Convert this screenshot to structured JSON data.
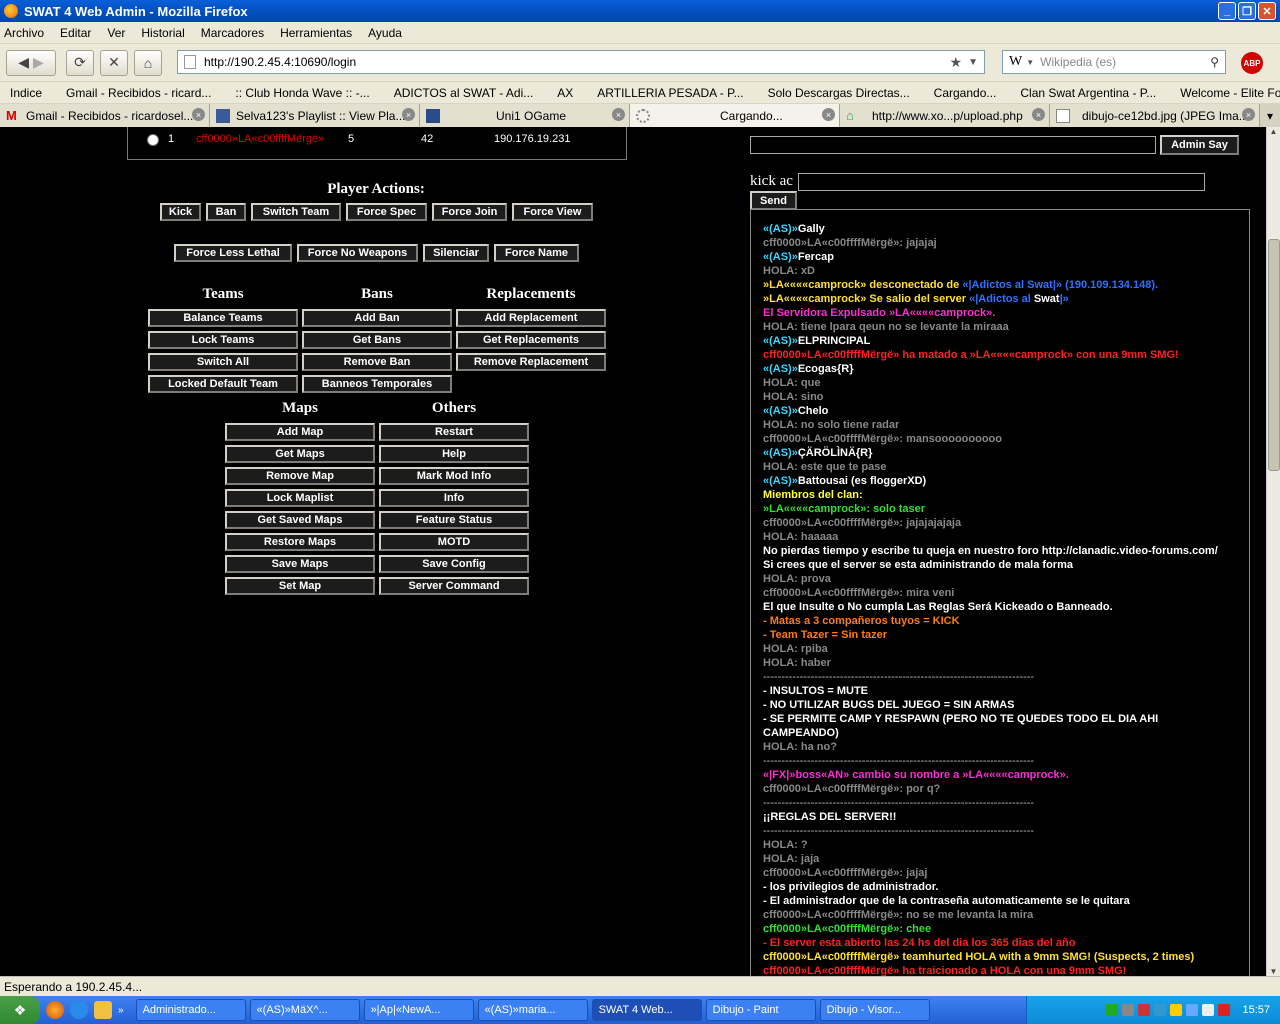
{
  "window": {
    "title": "SWAT 4 Web Admin - Mozilla Firefox"
  },
  "menu": [
    "Archivo",
    "Editar",
    "Ver",
    "Historial",
    "Marcadores",
    "Herramientas",
    "Ayuda"
  ],
  "nav": {
    "url": "http://190.2.45.4:10690/login",
    "search_placeholder": "Wikipedia (es)",
    "abp": "ABP"
  },
  "bookmarks": [
    "Indice",
    "Gmail - Recibidos - ricard...",
    ":: Club Honda Wave :: -...",
    "ADICTOS al SWAT - Adi...",
    "AX",
    "ARTILLERIA PESADA - P...",
    "Solo Descargas Directas...",
    "Cargando...",
    "Clan Swat Argentina - P...",
    "Welcome - Elite Force"
  ],
  "tabs": [
    "Gmail - Recibidos - ricardosel...",
    "Selva123's Playlist :: View Pla...",
    "Uni1 OGame",
    "Cargando...",
    "http://www.xo...p/upload.php",
    "dibujo-ce12bd.jpg (JPEG Ima..."
  ],
  "player": {
    "index": "1",
    "name": "cff0000»LA«c00ffffMërgë»",
    "score": "5",
    "ping": "42",
    "ip": "190.176.19.231"
  },
  "actions": {
    "heading": "Player Actions:",
    "row1": [
      "Kick",
      "Ban",
      "Switch Team",
      "Force Spec",
      "Force Join",
      "Force View"
    ],
    "row2": [
      "Force Less Lethal",
      "Force No Weapons",
      "Silenciar",
      "Force Name"
    ]
  },
  "groups": {
    "teams": "Teams",
    "bans": "Bans",
    "replacements": "Replacements",
    "maps": "Maps",
    "others": "Others"
  },
  "teams": [
    "Balance Teams",
    "Lock Teams",
    "Switch All",
    "Locked Default Team"
  ],
  "bans": [
    "Add Ban",
    "Get Bans",
    "Remove Ban",
    "Banneos Temporales"
  ],
  "replacements": [
    "Add Replacement",
    "Get Replacements",
    "Remove Replacement"
  ],
  "maps": [
    "Add Map",
    "Get Maps",
    "Remove Map",
    "Lock Maplist",
    "Get Saved Maps",
    "Restore Maps",
    "Save Maps",
    "Set Map"
  ],
  "others": [
    "Restart",
    "Help",
    "Mark Mod Info",
    "Info",
    "Feature Status",
    "MOTD",
    "Save Config",
    "Server Command"
  ],
  "admin": {
    "say_button": "Admin Say",
    "kick_label": "kick ac",
    "send_button": "Send"
  },
  "chat": [
    {
      "parts": [
        {
          "t": "«(AS)»",
          "c": "#39d8ff"
        },
        {
          "t": "Gally",
          "c": "#fff"
        }
      ]
    },
    {
      "parts": [
        {
          "t": "cff0000»LA«c00ffffMërgë»",
          "c": "#888"
        },
        {
          "t": ": jajajaj",
          "c": "#888"
        }
      ]
    },
    {
      "parts": [
        {
          "t": "«(AS)»",
          "c": "#39d8ff"
        },
        {
          "t": "Fercap",
          "c": "#fff"
        }
      ]
    },
    {
      "parts": [
        {
          "t": "HOLA",
          "c": "#888"
        },
        {
          "t": ": xD",
          "c": "#888"
        }
      ]
    },
    {
      "parts": [
        {
          "t": "»LA««««camprock»",
          "c": "#ffe030"
        },
        {
          "t": " desconectado de ",
          "c": "#ffe030"
        },
        {
          "t": "«|Adictos ",
          "c": "#3070ff"
        },
        {
          "t": "al",
          "c": "#3070ff"
        },
        {
          "t": " Swat",
          "c": "#3070ff"
        },
        {
          "t": "|» (190.109.134.148).",
          "c": "#3070ff"
        }
      ]
    },
    {
      "parts": [
        {
          "t": "»LA««««camprock»",
          "c": "#ffe030"
        },
        {
          "t": " Se salio del server ",
          "c": "#ffe030"
        },
        {
          "t": "«|Adictos ",
          "c": "#3070ff"
        },
        {
          "t": "al",
          "c": "#3070ff"
        },
        {
          "t": " Swat",
          "c": "#fff"
        },
        {
          "t": "|»",
          "c": "#3070ff"
        }
      ]
    },
    {
      "parts": [
        {
          "t": "El Servidor",
          "c": "#ff2ad4"
        },
        {
          "t": "a Expulsado ",
          "c": "#ff2ad4"
        },
        {
          "t": "»LA««««camprock»",
          "c": "#ff2ad4"
        },
        {
          "t": ".",
          "c": "#ff2ad4"
        }
      ]
    },
    {
      "parts": [
        {
          "t": "HOLA",
          "c": "#888"
        },
        {
          "t": ": tiene lpara qeun no se levante la miraaa",
          "c": "#888"
        }
      ]
    },
    {
      "parts": [
        {
          "t": "«(AS)»",
          "c": "#39d8ff"
        },
        {
          "t": "ELPRINCIPAL",
          "c": "#fff"
        }
      ]
    },
    {
      "parts": [
        {
          "t": "cff0000»LA«c00ffffMërgë»",
          "c": "#ff2020"
        },
        {
          "t": " ha matado a ",
          "c": "#ff2020"
        },
        {
          "t": "»LA««««camprock»",
          "c": "#ff2020"
        },
        {
          "t": " con una 9mm SMG!",
          "c": "#ff2020"
        }
      ]
    },
    {
      "parts": [
        {
          "t": "«(AS)»",
          "c": "#39d8ff"
        },
        {
          "t": "Ecogas{R}",
          "c": "#fff"
        }
      ]
    },
    {
      "parts": [
        {
          "t": "HOLA",
          "c": "#888"
        },
        {
          "t": ": que",
          "c": "#888"
        }
      ]
    },
    {
      "parts": [
        {
          "t": "HOLA",
          "c": "#888"
        },
        {
          "t": ": sino",
          "c": "#888"
        }
      ]
    },
    {
      "parts": [
        {
          "t": "«(AS)»",
          "c": "#39d8ff"
        },
        {
          "t": "Chelo",
          "c": "#fff"
        }
      ]
    },
    {
      "parts": [
        {
          "t": "HOLA",
          "c": "#888"
        },
        {
          "t": ": no solo tiene radar",
          "c": "#888"
        }
      ]
    },
    {
      "parts": [
        {
          "t": "cff0000»LA«c00ffffMërgë»",
          "c": "#888"
        },
        {
          "t": ": mansoooooooooo",
          "c": "#888"
        }
      ]
    },
    {
      "parts": [
        {
          "t": "«(AS)»",
          "c": "#39d8ff"
        },
        {
          "t": "ÇÄRÖLÌNÄ{R}",
          "c": "#fff"
        }
      ]
    },
    {
      "parts": [
        {
          "t": "HOLA",
          "c": "#888"
        },
        {
          "t": ": este que te pase",
          "c": "#888"
        }
      ]
    },
    {
      "parts": [
        {
          "t": "«(AS)»",
          "c": "#39d8ff"
        },
        {
          "t": "Battousai (es floggerXD)",
          "c": "#fff"
        }
      ]
    },
    {
      "parts": [
        {
          "t": "Miembros del clan:",
          "c": "#ffff30"
        }
      ]
    },
    {
      "parts": [
        {
          "t": "»LA««««camprock»",
          "c": "#30e030"
        },
        {
          "t": ": solo taser",
          "c": "#30e030"
        }
      ]
    },
    {
      "parts": [
        {
          "t": "cff0000»LA«c00ffffMërgë»",
          "c": "#888"
        },
        {
          "t": ": jajajajajaja",
          "c": "#888"
        }
      ]
    },
    {
      "parts": [
        {
          "t": "HOLA",
          "c": "#888"
        },
        {
          "t": ": haaaaa",
          "c": "#888"
        }
      ]
    },
    {
      "parts": [
        {
          "t": "No pierdas tiempo y escribe tu queja en nuestro foro http://clanadic.video-forums.com/",
          "c": "#fff"
        }
      ]
    },
    {
      "parts": [
        {
          "t": "Si crees que el server se esta administrando de mala forma",
          "c": "#fff"
        }
      ]
    },
    {
      "parts": [
        {
          "t": "HOLA",
          "c": "#888"
        },
        {
          "t": ": prova",
          "c": "#888"
        }
      ]
    },
    {
      "parts": [
        {
          "t": "cff0000»LA«c00ffffMërgë»",
          "c": "#888"
        },
        {
          "t": ": mira veni",
          "c": "#888"
        }
      ]
    },
    {
      "parts": [
        {
          "t": "El que Insulte o No cumpla Las Reglas Será Kickeado o Banneado.",
          "c": "#fff"
        }
      ]
    },
    {
      "parts": [
        {
          "t": "- Matas a 3 compañeros tuyos = KICK",
          "c": "#ff7a10"
        }
      ]
    },
    {
      "parts": [
        {
          "t": "- Team Tazer = Sin tazer",
          "c": "#ff7a10"
        }
      ]
    },
    {
      "parts": [
        {
          "t": "HOLA",
          "c": "#888"
        },
        {
          "t": ": rpiba",
          "c": "#888"
        }
      ]
    },
    {
      "parts": [
        {
          "t": "HOLA",
          "c": "#888"
        },
        {
          "t": ": haber",
          "c": "#888"
        }
      ]
    },
    {
      "sep": "--------------------------------------------------------------------------"
    },
    {
      "parts": [
        {
          "t": "- INSULTOS = MUTE",
          "c": "#fff"
        }
      ]
    },
    {
      "parts": [
        {
          "t": "- NO UTILIZAR BUGS DEL JUEGO = SIN ARMAS",
          "c": "#fff"
        }
      ]
    },
    {
      "parts": [
        {
          "t": "- SE PERMITE CAMP Y RESPAWN (PERO NO TE QUEDES TODO EL DIA AHI CAMPEANDO)",
          "c": "#fff"
        }
      ]
    },
    {
      "parts": [
        {
          "t": "HOLA",
          "c": "#888"
        },
        {
          "t": ": ha no?",
          "c": "#888"
        }
      ]
    },
    {
      "sep": "--------------------------------------------------------------------------"
    },
    {
      "parts": [
        {
          "t": "«|FX|»boss«AN»",
          "c": "#ff2ad4"
        },
        {
          "t": " cambio su nombre a ",
          "c": "#ff2ad4"
        },
        {
          "t": "»LA««««camprock»",
          "c": "#ff2ad4"
        },
        {
          "t": ".",
          "c": "#ff2ad4"
        }
      ]
    },
    {
      "parts": [
        {
          "t": "cff0000»LA«c00ffffMërgë»",
          "c": "#888"
        },
        {
          "t": ": por q?",
          "c": "#888"
        }
      ]
    },
    {
      "sep": "--------------------------------------------------------------------------"
    },
    {
      "parts": [
        {
          "t": "¡¡REGLAS DEL SERVER!!",
          "c": "#fff"
        }
      ]
    },
    {
      "sep": "--------------------------------------------------------------------------"
    },
    {
      "parts": [
        {
          "t": "HOLA",
          "c": "#888"
        },
        {
          "t": ": ?",
          "c": "#888"
        }
      ]
    },
    {
      "parts": [
        {
          "t": "HOLA",
          "c": "#888"
        },
        {
          "t": ": jaja",
          "c": "#888"
        }
      ]
    },
    {
      "parts": [
        {
          "t": "cff0000»LA«c00ffffMërgë»",
          "c": "#888"
        },
        {
          "t": ": jajaj",
          "c": "#888"
        }
      ]
    },
    {
      "parts": [
        {
          "t": "- los privilegios de administrador.",
          "c": "#fff"
        }
      ]
    },
    {
      "parts": [
        {
          "t": "- El administrador que de la contraseña automaticamente se le quitara",
          "c": "#fff"
        }
      ]
    },
    {
      "parts": [
        {
          "t": "cff0000»LA«c00ffffMërgë»",
          "c": "#888"
        },
        {
          "t": ": no se me levanta la mira",
          "c": "#888"
        }
      ]
    },
    {
      "parts": [
        {
          "t": "cff0000»LA«c00ffffMërgë»",
          "c": "#30e030"
        },
        {
          "t": ": chee",
          "c": "#30e030"
        }
      ]
    },
    {
      "parts": [
        {
          "t": "- El server esta abierto las 24 hs del dia los 365 dias del año",
          "c": "#ff2020"
        }
      ]
    },
    {
      "parts": [
        {
          "t": "cff0000»LA«c00ffffMërgë»",
          "c": "#ffe030"
        },
        {
          "t": " teamhurted ",
          "c": "#ffe030"
        },
        {
          "t": "HOLA",
          "c": "#ffe030"
        },
        {
          "t": " with a 9mm SMG! (Suspects, 2 times)",
          "c": "#ffe030"
        }
      ]
    },
    {
      "parts": [
        {
          "t": "cff0000»LA«c00ffffMërgë»",
          "c": "#ff2020"
        },
        {
          "t": " ha traicionado a ",
          "c": "#ff2020"
        },
        {
          "t": "HOLA",
          "c": "#ff2020"
        },
        {
          "t": " con una 9mm SMG!",
          "c": "#ff2020"
        }
      ]
    }
  ],
  "status": "Esperando a 190.2.45.4...",
  "taskbar": {
    "tasks": [
      "Administrado...",
      "«(AS)»MäX^...",
      "»|Ap|«NewA...",
      "«(AS)»maria...",
      "SWAT 4 Web...",
      "Dibujo - Paint",
      "Dibujo - Visor..."
    ],
    "time": "15:57"
  }
}
